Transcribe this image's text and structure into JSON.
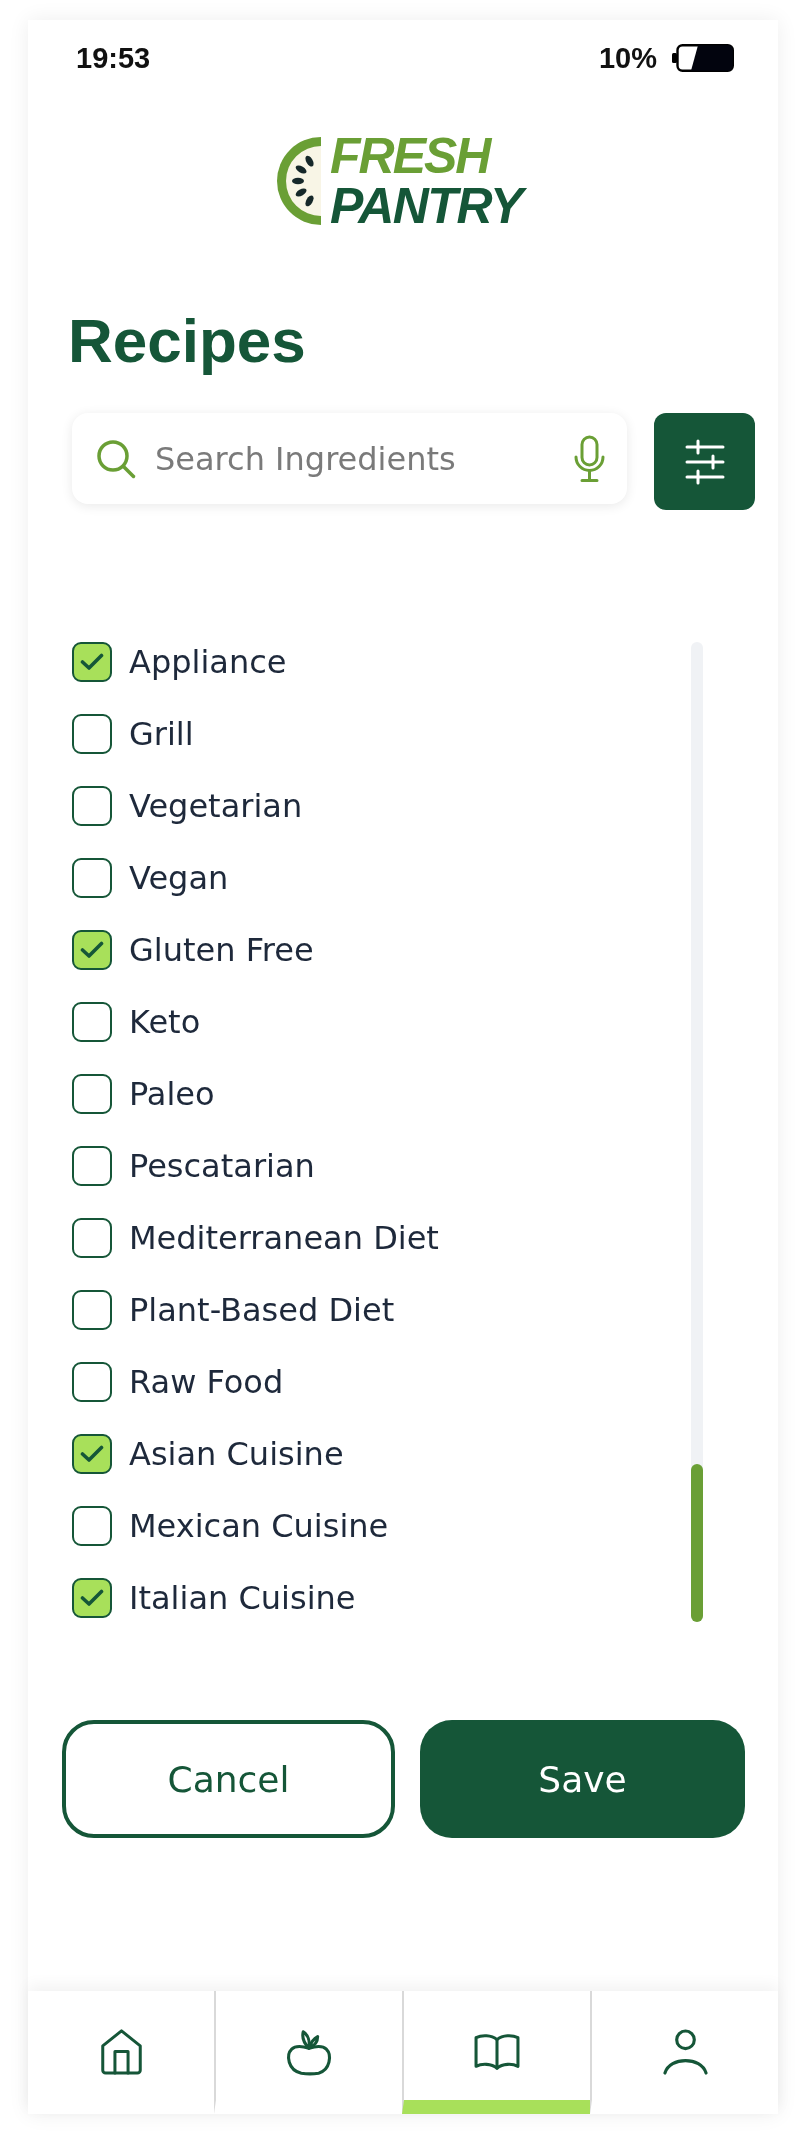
{
  "status_bar": {
    "time": "19:53",
    "battery": "10%"
  },
  "logo": {
    "top": "FRESH",
    "bottom": "PANTRY"
  },
  "title": "Recipes",
  "search": {
    "placeholder": "Search Ingredients"
  },
  "filters": [
    {
      "label": "Appliance",
      "checked": true
    },
    {
      "label": "Grill",
      "checked": false
    },
    {
      "label": "Vegetarian",
      "checked": false
    },
    {
      "label": "Vegan",
      "checked": false
    },
    {
      "label": "Gluten Free",
      "checked": true
    },
    {
      "label": "Keto",
      "checked": false
    },
    {
      "label": "Paleo",
      "checked": false
    },
    {
      "label": "Pescatarian",
      "checked": false
    },
    {
      "label": "Mediterranean Diet",
      "checked": false
    },
    {
      "label": "Plant-Based Diet",
      "checked": false
    },
    {
      "label": "Raw Food",
      "checked": false
    },
    {
      "label": "Asian Cuisine",
      "checked": true
    },
    {
      "label": "Mexican Cuisine",
      "checked": false
    },
    {
      "label": "Italian Cuisine",
      "checked": true
    }
  ],
  "buttons": [
    {
      "label": "Cancel",
      "kind": "outline"
    },
    {
      "label": "Save",
      "kind": "filled"
    }
  ],
  "nav": {
    "items": [
      {
        "kind": "home",
        "selected": false
      },
      {
        "kind": "produce",
        "selected": false
      },
      {
        "kind": "recipes",
        "selected": true
      },
      {
        "kind": "profile",
        "selected": false
      }
    ]
  }
}
